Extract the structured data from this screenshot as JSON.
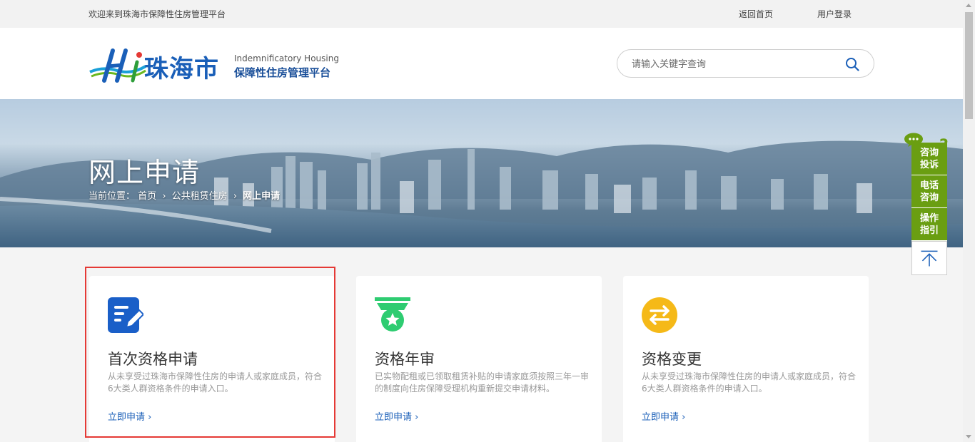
{
  "topbar": {
    "welcome": "欢迎来到珠海市保障性住房管理平台",
    "home_link": "返回首页",
    "login_link": "用户登录"
  },
  "header": {
    "logo_city": "珠海市",
    "logo_en": "Indemnificatory Housing",
    "logo_cn": "保障性住房管理平台",
    "search_placeholder": "请输入关键字查询"
  },
  "banner": {
    "title": "网上申请",
    "breadcrumb_label": "当前位置：",
    "breadcrumb": [
      "首页",
      "公共租赁住房",
      "网上申请"
    ],
    "separator": "›"
  },
  "side": {
    "items": [
      "咨询\n投诉",
      "电话\n咨询",
      "操作\n指引"
    ],
    "items_lines": [
      [
        "咨询",
        "投诉"
      ],
      [
        "电话",
        "咨询"
      ],
      [
        "操作",
        "指引"
      ]
    ],
    "qmark": "?"
  },
  "cards": [
    {
      "icon": "edit-document-icon",
      "color": "#1a5fc8",
      "title": "首次资格申请",
      "desc": "从未享受过珠海市保障性住房的申请人或家庭成员，符合6大类人群资格条件的申请入口。",
      "apply": "立即申请 ›"
    },
    {
      "icon": "medal-star-icon",
      "color": "#2ecc71",
      "title": "资格年审",
      "desc": "已实物配租或已领取租赁补贴的申请家庭须按照三年一审的制度向住房保障受理机构重新提交申请材料。",
      "apply": "立即申请 ›"
    },
    {
      "icon": "swap-arrows-icon",
      "color": "#f5b918",
      "title": "资格变更",
      "desc": "从未享受过珠海市保障性住房的申请人或家庭成员，符合6大类人群资格条件的申请入口。",
      "apply": "立即申请 ›"
    }
  ],
  "colors": {
    "accent_blue": "#1a5fb8",
    "side_green": "#6a9e12",
    "highlight_red": "#e53935"
  }
}
